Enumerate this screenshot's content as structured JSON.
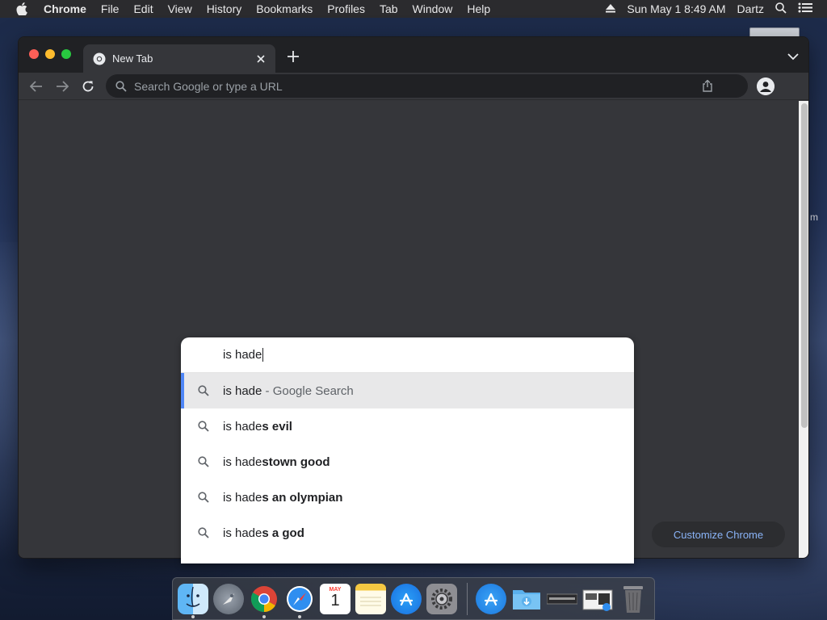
{
  "menubar": {
    "app_name": "Chrome",
    "items": [
      "File",
      "Edit",
      "View",
      "History",
      "Bookmarks",
      "Profiles",
      "Tab",
      "Window",
      "Help"
    ],
    "datetime": "Sun May 1  8:49 AM",
    "user": "Dartz"
  },
  "desktop": {
    "partial_label": "m"
  },
  "browser": {
    "tab": {
      "title": "New Tab"
    },
    "omnibox": {
      "placeholder": "Search Google or type a URL"
    },
    "customize_label": "Customize Chrome"
  },
  "dropdown": {
    "typed_text": "is hade",
    "suggestions": [
      {
        "base": "is hade",
        "bold": "",
        "suffix": " - Google Search",
        "selected": true
      },
      {
        "base": "is hade",
        "bold": "s evil",
        "suffix": "",
        "selected": false
      },
      {
        "base": "is hade",
        "bold": "stown good",
        "suffix": "",
        "selected": false
      },
      {
        "base": "is hade",
        "bold": "s an olympian",
        "suffix": "",
        "selected": false
      },
      {
        "base": "is hade",
        "bold": "s a god",
        "suffix": "",
        "selected": false
      }
    ]
  },
  "dock": {
    "apps": [
      "finder-icon",
      "launchpad-icon",
      "chrome-icon",
      "safari-icon",
      "calendar-icon",
      "notes-icon",
      "app-store-icon",
      "system-preferences-icon"
    ],
    "calendar_month": "MAY",
    "calendar_day": "1",
    "others": [
      "applications-folder-icon",
      "downloads-folder-icon",
      "document-stack-icon",
      "screenshot-stack-icon",
      "trash-icon"
    ]
  },
  "colors": {
    "accent": "#4f86f7",
    "link": "#8ab4f8",
    "toolbar": "#35363a",
    "tabstrip": "#202124"
  }
}
